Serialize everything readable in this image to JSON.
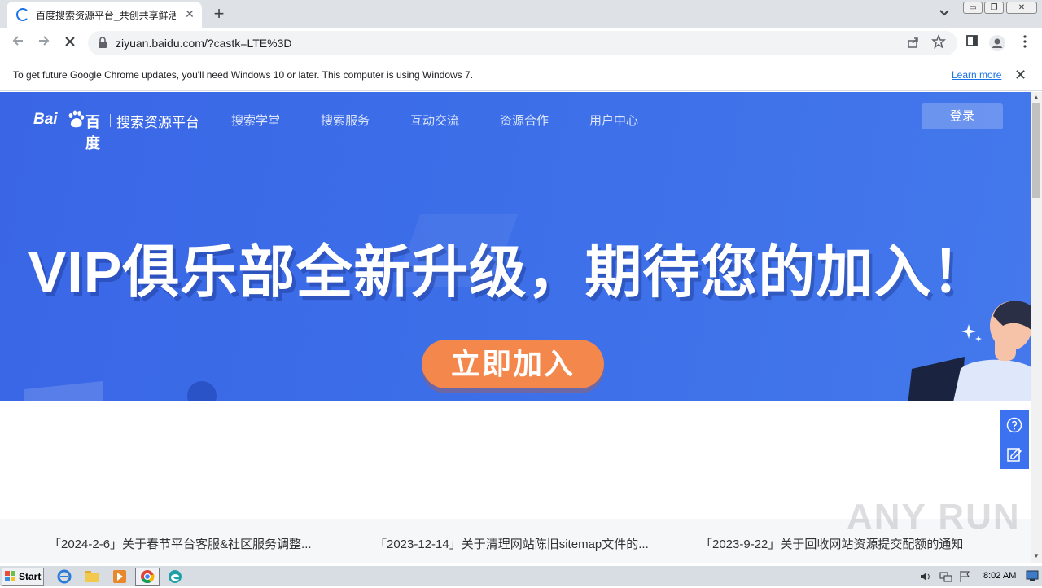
{
  "browser": {
    "tab_title": "百度搜索资源平台_共创共享鲜活搜",
    "tab_close": "✕",
    "new_tab": "+",
    "url": "ziyuan.baidu.com/?castk=LTE%3D",
    "window_controls": [
      "▭",
      "❐",
      "✕"
    ]
  },
  "infobar": {
    "message": "To get future Google Chrome updates, you'll need Windows 10 or later. This computer is using Windows 7.",
    "learn_more": "Learn more",
    "close": "✕"
  },
  "site": {
    "logo_bai": "Bai",
    "logo_du": "百度",
    "site_name": "搜索资源平台",
    "nav": [
      "搜索学堂",
      "搜索服务",
      "互动交流",
      "资源合作",
      "用户中心"
    ],
    "login": "登录",
    "headline": "VIP俱乐部全新升级，期待您的加入！",
    "join_button": "立即加入"
  },
  "news": [
    "「2024-2-6」关于春节平台客服&社区服务调整...",
    "「2023-12-14」关于清理网站陈旧sitemap文件的...",
    "「2023-9-22」关于回收网站资源提交配额的通知"
  ],
  "watermark": "ANY RUN",
  "taskbar": {
    "start": "Start",
    "clock": "8:02 AM"
  },
  "colors": {
    "banner_blue": "#3c6ee8",
    "join_orange": "#f4874b",
    "link_blue": "#1a73e8"
  }
}
